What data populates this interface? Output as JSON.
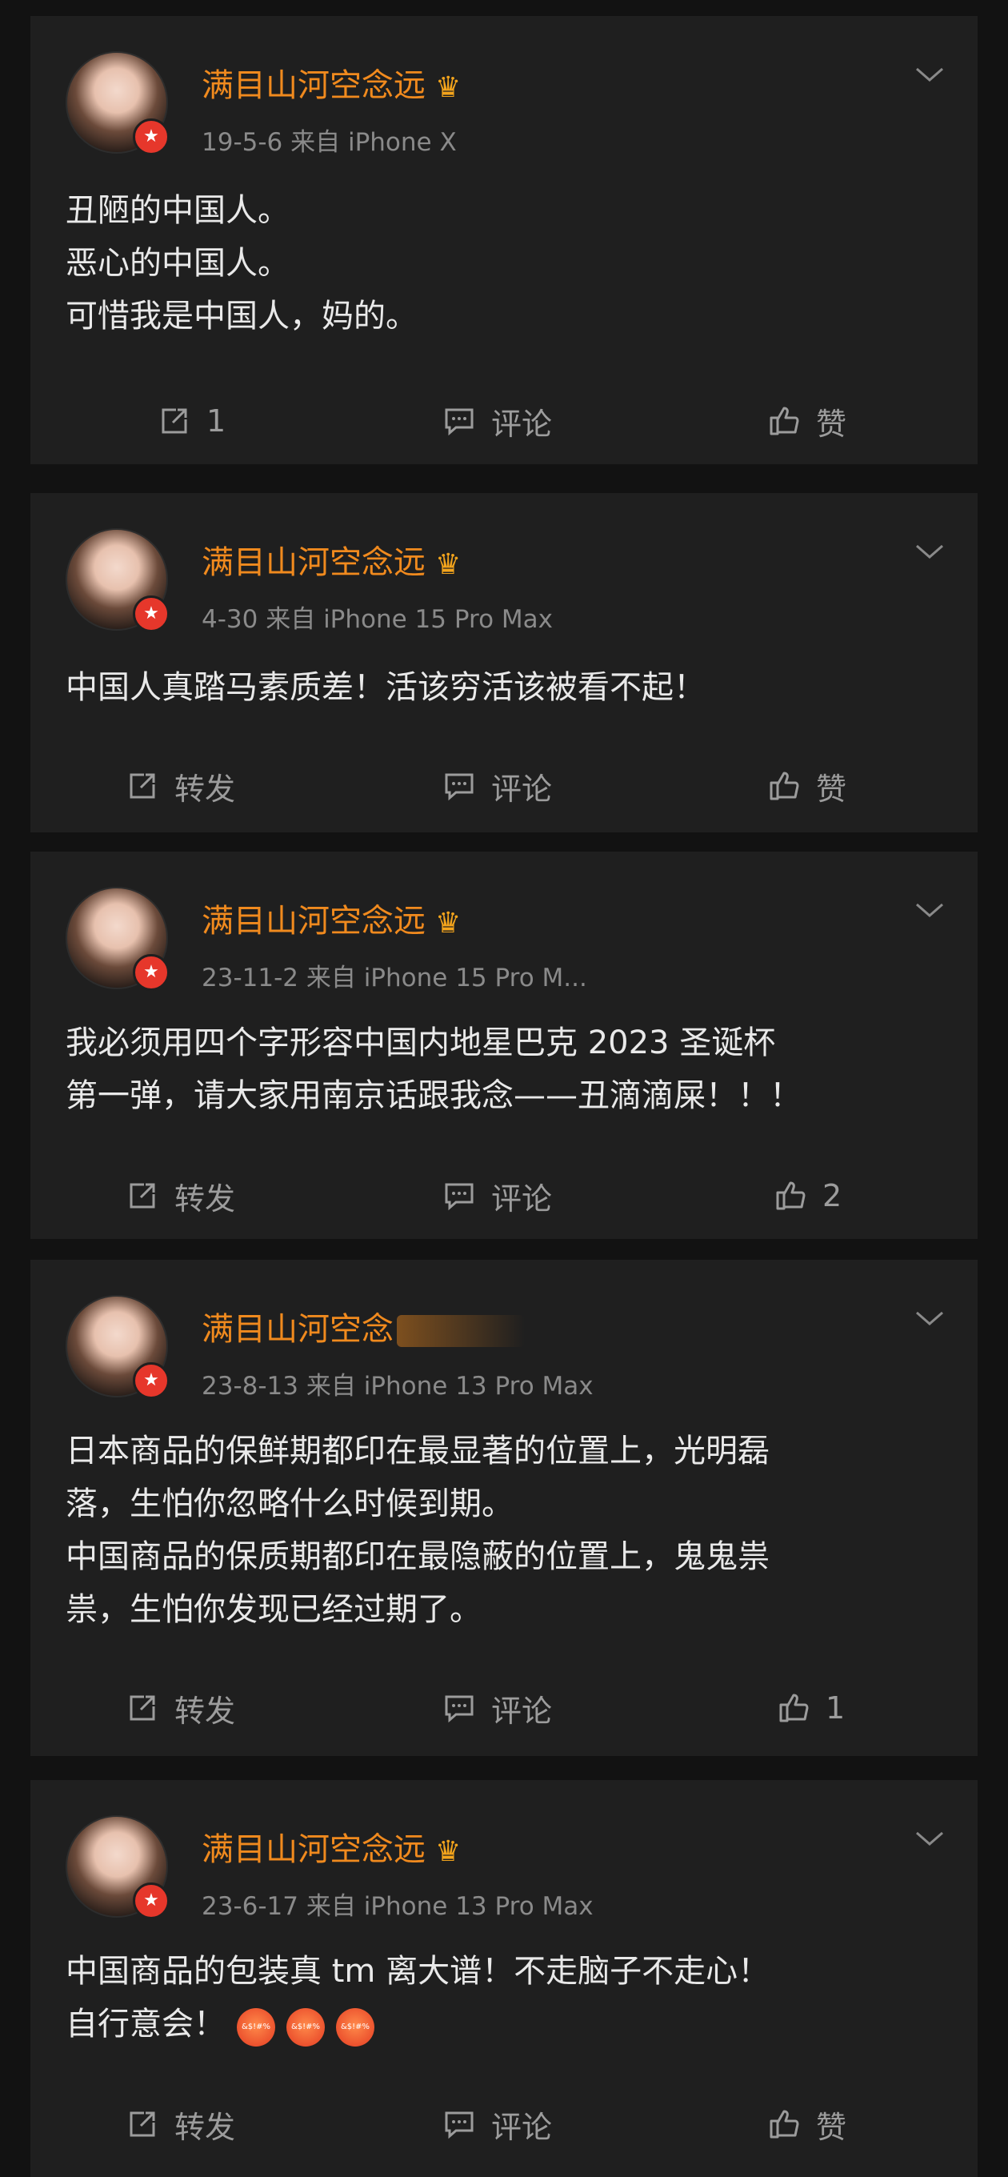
{
  "colors": {
    "background": "#121212",
    "card": "#1f1f1f",
    "username": "#f08a1e",
    "meta": "#8a8a8a",
    "text": "#e9e9e9",
    "action": "#9c9c9c",
    "badge": "#e6372b"
  },
  "posts": [
    {
      "username": "满目山河空念远",
      "meta": "19-5-6  来自 iPhone X",
      "lines": [
        "丑陋的中国人。",
        "恶心的中国人。",
        "可惜我是中国人，妈的。"
      ],
      "actions": {
        "share": "1",
        "comment": "评论",
        "like": "赞"
      }
    },
    {
      "username": "满目山河空念远",
      "meta": "4-30  来自 iPhone 15 Pro Max",
      "lines": [
        "中国人真踏马素质差！活该穷活该被看不起！"
      ],
      "actions": {
        "share": "转发",
        "comment": "评论",
        "like": "赞"
      }
    },
    {
      "username": "满目山河空念远",
      "meta": "23-11-2  来自 iPhone 15 Pro M...",
      "lines": [
        "我必须用四个字形容中国内地星巴克 2023 圣诞杯",
        "第一弹，请大家用南京话跟我念——丑滴滴屎！！！"
      ],
      "actions": {
        "share": "转发",
        "comment": "评论",
        "like": "2"
      }
    },
    {
      "username": "满目山河空念",
      "meta": "23-8-13  来自 iPhone 13 Pro Max",
      "lines": [
        "日本商品的保鲜期都印在最显著的位置上，光明磊",
        "落，生怕你忽略什么时候到期。",
        "中国商品的保质期都印在最隐蔽的位置上，鬼鬼祟",
        "祟，生怕你发现已经过期了。"
      ],
      "actions": {
        "share": "转发",
        "comment": "评论",
        "like": "1"
      }
    },
    {
      "username": "满目山河空念远",
      "meta": "23-6-17  来自 iPhone 13 Pro Max",
      "lines": [
        "中国商品的包装真 tm 离大谱！不走脑子不走心！",
        "自行意会！"
      ],
      "emoji_labels": [
        "&$!#%",
        "&$!#%",
        "&$!#%"
      ],
      "actions": {
        "share": "转发",
        "comment": "评论",
        "like": "赞"
      }
    }
  ]
}
